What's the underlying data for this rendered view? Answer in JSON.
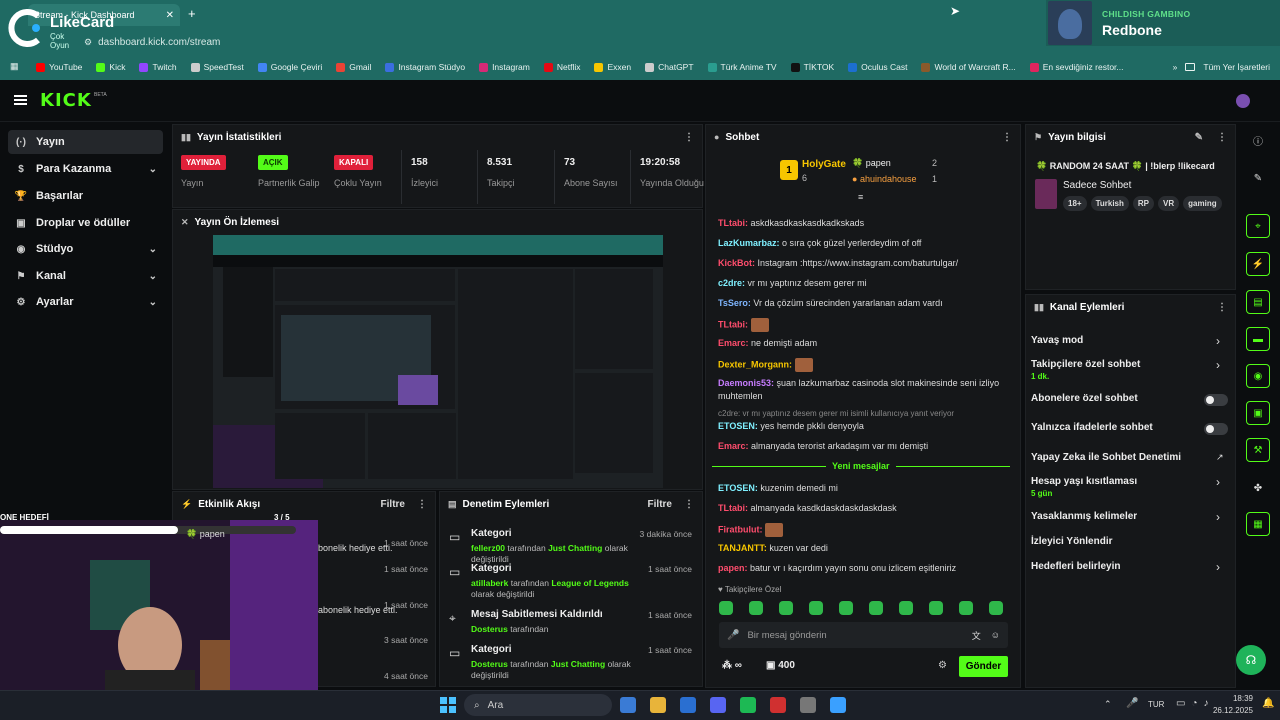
{
  "browser": {
    "tab_title": "Stream - Kick Dashboard",
    "tab_close": "✕",
    "new_tab": "+",
    "url": "dashboard.kick.com/stream",
    "overlay_brand": "LikeCard",
    "overlay_sub": "Çok Oyun",
    "bookmarks": [
      {
        "label": "YouTube",
        "color": "#ff0000"
      },
      {
        "label": "Kick",
        "color": "#53fc18"
      },
      {
        "label": "Twitch",
        "color": "#9146ff"
      },
      {
        "label": "SpeedTest",
        "color": "#cccccc"
      },
      {
        "label": "Google Çeviri",
        "color": "#4285f4"
      },
      {
        "label": "Gmail",
        "color": "#ea4335"
      },
      {
        "label": "Instagram Stüdyo",
        "color": "#3b6ee0"
      },
      {
        "label": "Instagram",
        "color": "#d62976"
      },
      {
        "label": "Netflix",
        "color": "#e50914"
      },
      {
        "label": "Exxen",
        "color": "#f7c600"
      },
      {
        "label": "ChatGPT",
        "color": "#cccccc"
      },
      {
        "label": "Türk Anime TV",
        "color": "#2a9d8f"
      },
      {
        "label": "TİKTOK",
        "color": "#111111"
      },
      {
        "label": "Oculus Cast",
        "color": "#1c6fd0"
      },
      {
        "label": "World of Warcraft R...",
        "color": "#8a5a2b"
      },
      {
        "label": "En sevdiğiniz restor...",
        "color": "#e0245e"
      }
    ],
    "bookmarks_more": "»",
    "all_bookmarks": "Tüm Yer İşaretleri"
  },
  "music": {
    "artist": "CHILDISH GAMBINO",
    "song": "Redbone"
  },
  "kick": {
    "logo": "KICK",
    "beta": "BETA"
  },
  "sidebar": {
    "items": [
      {
        "label": "Yayın",
        "icon": "(·)"
      },
      {
        "label": "Para Kazanma",
        "icon": "$"
      },
      {
        "label": "Başarılar",
        "icon": "🏆"
      },
      {
        "label": "Droplar ve ödüller",
        "icon": "▣"
      },
      {
        "label": "Stüdyo",
        "icon": "◉"
      },
      {
        "label": "Kanal",
        "icon": "⚑"
      },
      {
        "label": "Ayarlar",
        "icon": "⚙"
      }
    ]
  },
  "stats": {
    "title": "Yayın İstatistikleri",
    "items": [
      {
        "value": "YAYINDA",
        "label": "Yayın",
        "color": "#e0203a"
      },
      {
        "value": "AÇIK",
        "label": "Partnerlik Galip",
        "color": "#53fc18"
      },
      {
        "value": "KAPALI",
        "label": "Çoklu Yayın",
        "color": "#e0203a"
      },
      {
        "value": "158",
        "label": "İzleyici"
      },
      {
        "value": "8.531",
        "label": "Takipçi"
      },
      {
        "value": "73",
        "label": "Abone Sayısı"
      },
      {
        "value": "19:20:58",
        "label": "Yayında Olduğu"
      }
    ]
  },
  "preview": {
    "title": "Yayın Ön İzlemesi"
  },
  "activity": {
    "title": "Etkinlik Akışı",
    "filter": "Filtre",
    "goal_label": "ONE HEDEFİ",
    "goal_progress": "3 / 5",
    "goal_fraction": 0.6,
    "goal_user": "papen",
    "items": [
      {
        "text": "bonelik hediye etti.",
        "time": "1 saat önce"
      },
      {
        "text": "",
        "time": "1 saat önce"
      },
      {
        "text": "abonelik hediye etti.",
        "time": "1 saat önce"
      },
      {
        "text": "",
        "time": "3 saat önce"
      },
      {
        "text": "",
        "time": "4 saat önce"
      }
    ]
  },
  "moderation": {
    "title": "Denetim Eylemleri",
    "filter": "Filtre",
    "items": [
      {
        "title": "Kategori",
        "user": "fellerz00",
        "mid": "tarafından",
        "target": "Just Chatting",
        "tail": "olarak değiştirildi",
        "time": "3 dakika önce"
      },
      {
        "title": "Kategori",
        "user": "atillaberk",
        "mid": "tarafından",
        "target": "League of Legends",
        "tail": "olarak değiştirildi",
        "time": "1 saat önce"
      },
      {
        "title": "Mesaj Sabitlemesi Kaldırıldı",
        "user": "Dosterus",
        "mid": "tarafından",
        "target": "",
        "tail": "",
        "time": "1 saat önce"
      },
      {
        "title": "Kategori",
        "user": "Dosterus",
        "mid": "tarafından",
        "target": "Just Chatting",
        "tail": "olarak değiştirildi",
        "time": "1 saat önce"
      }
    ]
  },
  "chat": {
    "title": "Sohbet",
    "leaders": {
      "first_name": "HolyGate",
      "first_count": "6",
      "rank": "1",
      "second_name": "papen",
      "second_count": "2",
      "third_name": "ahuindahouse",
      "third_count": "1"
    },
    "messages": [
      {
        "user": "TLtabi:",
        "color": "#ff4d6d",
        "text": "askdkasdkaskasdkadkskads"
      },
      {
        "user": "LazKumarbaz:",
        "color": "#7ff0ff",
        "text": "o sıra çok güzel yerlerdeydim of off"
      },
      {
        "user": "KickBot:",
        "color": "#ff4d6d",
        "text": "Instagram :https://www.instagram.com/baturtulgar/"
      },
      {
        "user": "c2dre:",
        "color": "#7ff0ff",
        "text": "vr mı yaptınız desem gerer mi"
      },
      {
        "user": "TsSero:",
        "color": "#7fb6ff",
        "text": "Vr da çözüm sürecinden yararlanan adam vardı"
      },
      {
        "user": "TLtabi:",
        "color": "#ff4d6d",
        "text": ""
      },
      {
        "user": "Emarc:",
        "color": "#ff4d6d",
        "text": "ne demişti adam"
      },
      {
        "user": "Dexter_Morgann:",
        "color": "#f7c600",
        "text": ""
      },
      {
        "user": "Daemonis53:",
        "color": "#c77dff",
        "text": "şuan lazkumarbaz casinoda slot makinesinde seni izliyo"
      },
      {
        "user": "",
        "color": "#dddddd",
        "text": "muhtemlen"
      }
    ],
    "reply_hint": "c2dre: vr mı yaptınız desem gerer mi isimli kullanıcıya yanıt veriyor",
    "reply_msg": {
      "user": "ETOSEN:",
      "color": "#7ff0ff",
      "text": "yes hemde pkklı denyoyla"
    },
    "reply_msg2": {
      "user": "Emarc:",
      "color": "#ff4d6d",
      "text": "almanyada terorist arkadaşım var mı demişti"
    },
    "new_messages": "Yeni mesajlar",
    "new": [
      {
        "user": "ETOSEN:",
        "color": "#7ff0ff",
        "text": "kuzenim demedi mi"
      },
      {
        "user": "TLtabi:",
        "color": "#ff4d6d",
        "text": "almanyada kasdkdaskdaskdaskdask"
      },
      {
        "user": "Firatbulut:",
        "color": "#ff4d6d",
        "text": ""
      },
      {
        "user": "TANJANTT:",
        "color": "#f7c600",
        "text": "kuzen var dedi"
      },
      {
        "user": "papen:",
        "color": "#ff4d6d",
        "text": "batur vr ı kaçırdım yayın sonu onu izlicem eşitleniriz"
      }
    ],
    "follower_only": "Takipçilere Özel",
    "placeholder": "Bir mesaj gönderin",
    "points": "∞",
    "coins": "400",
    "send": "Gönder"
  },
  "stream_info": {
    "title": "Yayın bilgisi",
    "stream_title": "🍀 RANDOM 24 SAAT 🍀 | !blerp !likecard",
    "category": "Sadece Sohbet",
    "tags": [
      "18+",
      "Turkish",
      "RP",
      "VR",
      "gaming"
    ]
  },
  "channel_actions": {
    "title": "Kanal Eylemleri",
    "items": [
      {
        "label": "Yavaş mod",
        "sub": "",
        "control": "chevron"
      },
      {
        "label": "Takipçilere özel sohbet",
        "sub": "1 dk.",
        "control": "chevron"
      },
      {
        "label": "Abonelere özel sohbet",
        "sub": "",
        "control": "toggle"
      },
      {
        "label": "Yalnızca ifadelerle sohbet",
        "sub": "",
        "control": "toggle"
      },
      {
        "label": "Yapay Zeka ile Sohbet Denetimi",
        "sub": "",
        "control": "external"
      },
      {
        "label": "Hesap yaşı kısıtlaması",
        "sub": "5 gün",
        "control": "chevron"
      },
      {
        "label": "Yasaklanmış kelimeler",
        "sub": "",
        "control": "chevron"
      },
      {
        "label": "İzleyici Yönlendir",
        "sub": "",
        "control": "none"
      },
      {
        "label": "Hedefleri belirleyin",
        "sub": "",
        "control": "chevron"
      }
    ]
  },
  "taskbar": {
    "search": "Ara",
    "lang": "TUR",
    "time": "18:39",
    "date": "26.12.2025"
  }
}
